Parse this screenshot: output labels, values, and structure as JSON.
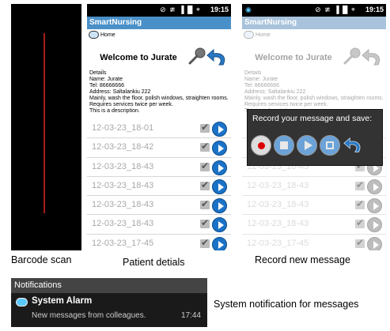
{
  "captions": {
    "barcode": "Barcode scan",
    "patient": "Patient detials",
    "record": "Record new message",
    "notification": "System notification for messages"
  },
  "status": {
    "time": "19:15",
    "icons": "⊘ ≇ ▐ █ ⌖"
  },
  "app": {
    "title": "SmartNursing",
    "home_label": "Home",
    "welcome": "Welcome to Jurate",
    "details": {
      "heading": "Details",
      "name": "Name: Jurate",
      "tel": "Tel: 86666666",
      "address": "Address: Saltalankiu 222",
      "line1": "Mainly, wash the floor, polish windows, straighten rooms.",
      "line2": "Requires services twice per week.",
      "line3": "This is a description."
    },
    "messages": [
      "12-03-23_18-01",
      "12-03-23_18-42",
      "12-03-23_18-43",
      "12-03-23_18-43",
      "12-03-23_18-43",
      "12-03-23_18-43",
      "12-03-23_17-45"
    ]
  },
  "dialog": {
    "title": "Record your message and save:"
  },
  "notification": {
    "header": "Notifications",
    "title": "System Alarm",
    "body": "New messages from colleagues.",
    "time": "17:44"
  },
  "colors": {
    "titlebar": "#4a90c8",
    "play": "#1b73c7",
    "barcode_line": "#a81a1a"
  }
}
